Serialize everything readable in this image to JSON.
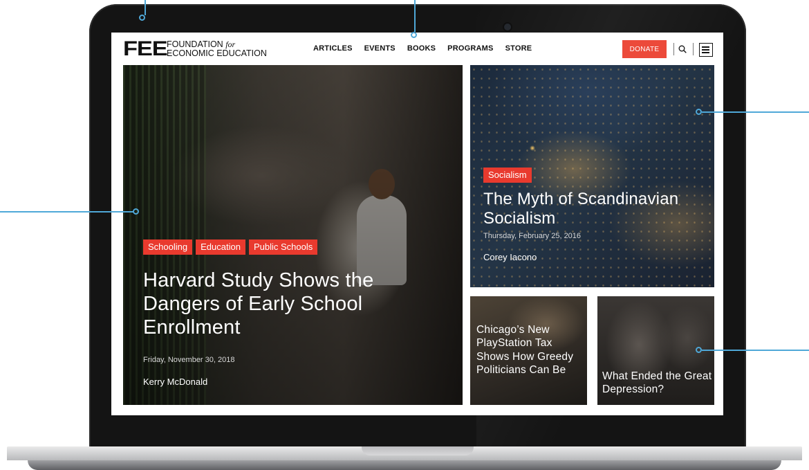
{
  "site": {
    "logo_mark": "FEE",
    "logo_line1": "FOUNDATION",
    "logo_for": "for",
    "logo_line2": "ECONOMIC EDUCATION"
  },
  "nav": {
    "items": [
      "ARTICLES",
      "EVENTS",
      "BOOKS",
      "PROGRAMS",
      "STORE"
    ],
    "donate_label": "DONATE"
  },
  "featured": {
    "tags": [
      "Schooling",
      "Education",
      "Public Schools"
    ],
    "title": "Harvard Study Shows the Dangers of Early School Enrollment",
    "date": "Friday, November 30, 2018",
    "author": "Kerry McDonald"
  },
  "side_article": {
    "tag": "Socialism",
    "title": "The Myth of Scandinavian Socialism",
    "date": "Thursday, February 25, 2016",
    "author": "Corey Iacono"
  },
  "small_articles": [
    {
      "title": "Chicago’s New PlayStation Tax Shows How Greedy Politicians Can Be"
    },
    {
      "title": "What Ended the Great Depression?"
    }
  ],
  "colors": {
    "accent": "#ec4a3a",
    "tag": "#e93a2e",
    "callout": "#4fa8d8"
  }
}
